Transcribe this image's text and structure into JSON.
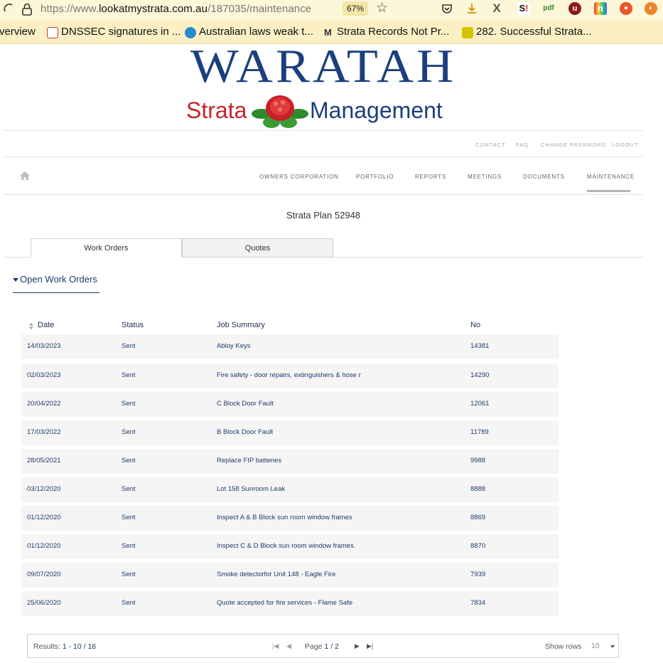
{
  "browser": {
    "url_prefix": "https://www.",
    "url_domain": "lookatmystrata.com.au",
    "url_path": "/187035/maintenance",
    "zoom": "67%",
    "bookmarks": [
      "verview",
      "DNSSEC signatures in ...",
      "Australian laws weak t...",
      "Strata Records Not Pr...",
      "282. Successful Strata..."
    ]
  },
  "logo": {
    "line1": "WARATAH",
    "word_strata": "Strata",
    "word_management": "Management"
  },
  "top_links": [
    "CONTACT",
    "FAQ",
    "CHANGE PASSWORD",
    "LOGOUT"
  ],
  "nav": [
    "OWNERS CORPORATION",
    "PORTFOLIO",
    "REPORTS",
    "MEETINGS",
    "DOCUMENTS",
    "MAINTENANCE"
  ],
  "plan_title": "Strata Plan 52948",
  "tabs": [
    "Work Orders",
    "Quotes"
  ],
  "section_title": "Open Work Orders",
  "table": {
    "headers": [
      "Date",
      "Status",
      "Job Summary",
      "No"
    ],
    "rows": [
      [
        "14/03/2023",
        "Sent",
        "Abloy Keys",
        "14381"
      ],
      [
        "02/03/2023",
        "Sent",
        "Fire safety - door repairs, extinguishers & hose r",
        "14290"
      ],
      [
        "20/04/2022",
        "Sent",
        "C Block Door Fault",
        "12061"
      ],
      [
        "17/03/2022",
        "Sent",
        "B Block Door Fault",
        "11789"
      ],
      [
        "28/05/2021",
        "Sent",
        "Replace FIP batteries",
        "9988"
      ],
      [
        "03/12/2020",
        "Sent",
        "Lot 158 Sunroom Leak",
        "8888"
      ],
      [
        "01/12/2020",
        "Sent",
        "Inspect A & B Block sun room window frames",
        "8869"
      ],
      [
        "01/12/2020",
        "Sent",
        "Inspect C & D Block sun room window frames.",
        "8870"
      ],
      [
        "09/07/2020",
        "Sent",
        "Smoke detectorfor Unit 148 - Eagle Fire",
        "7939"
      ],
      [
        "25/06/2020",
        "Sent",
        "Quote accepted for fire services - Flame Safe",
        "7834"
      ]
    ]
  },
  "pager": {
    "results_label": "Results:",
    "results_range": "1 - 10 / 16",
    "page_label": "Page",
    "page_value": "1 / 2",
    "show_rows_label": "Show rows",
    "rows_value": "10"
  }
}
